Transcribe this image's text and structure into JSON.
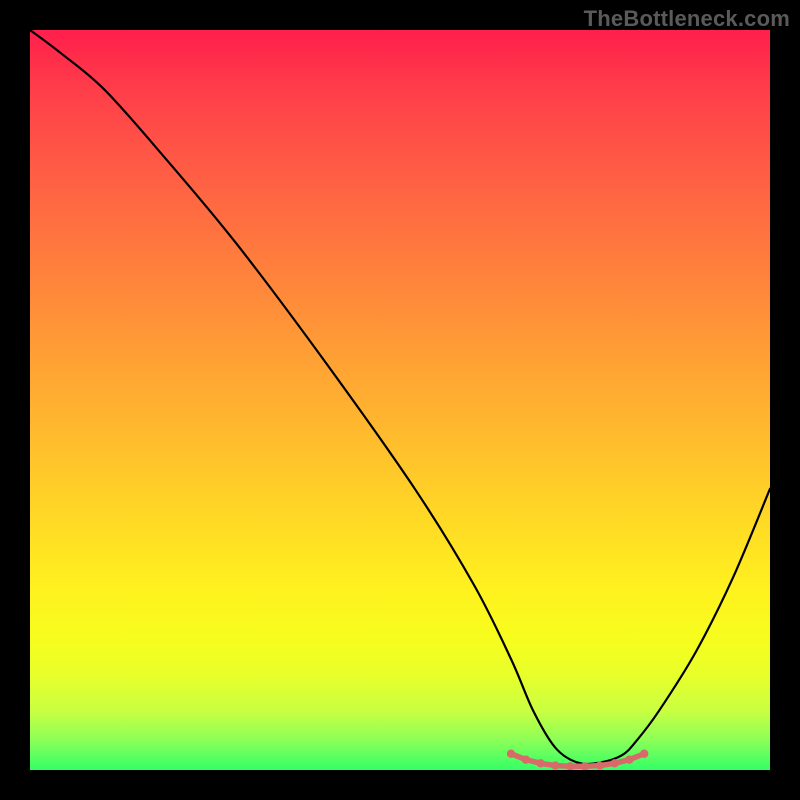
{
  "watermark": "TheBottleneck.com",
  "chart_data": {
    "type": "line",
    "title": "",
    "xlabel": "",
    "ylabel": "",
    "xlim": [
      0,
      100
    ],
    "ylim": [
      0,
      100
    ],
    "series": [
      {
        "name": "curve",
        "x": [
          0,
          4,
          10,
          18,
          28,
          40,
          52,
          60,
          65,
          68,
          71,
          74,
          77,
          80,
          82,
          85,
          90,
          95,
          100
        ],
        "y": [
          100,
          97,
          92,
          83,
          71,
          55,
          38,
          25,
          15,
          8,
          3,
          1,
          1,
          2,
          4,
          8,
          16,
          26,
          38
        ]
      }
    ],
    "markers": {
      "name": "bottom-markers",
      "color": "#d86a6a",
      "x": [
        65,
        67,
        69,
        71,
        73,
        75,
        77,
        79,
        81,
        83
      ],
      "y": [
        2.2,
        1.4,
        0.9,
        0.6,
        0.5,
        0.5,
        0.6,
        0.9,
        1.4,
        2.2
      ]
    },
    "gradient_stops": [
      {
        "pos": 0.0,
        "color": "#ff1f4b"
      },
      {
        "pos": 0.08,
        "color": "#ff3d4a"
      },
      {
        "pos": 0.18,
        "color": "#ff5a45"
      },
      {
        "pos": 0.3,
        "color": "#ff7a3e"
      },
      {
        "pos": 0.42,
        "color": "#ff9a36"
      },
      {
        "pos": 0.54,
        "color": "#ffb92e"
      },
      {
        "pos": 0.65,
        "color": "#ffd626"
      },
      {
        "pos": 0.75,
        "color": "#fff01f"
      },
      {
        "pos": 0.82,
        "color": "#f7fd1d"
      },
      {
        "pos": 0.87,
        "color": "#e9ff2a"
      },
      {
        "pos": 0.92,
        "color": "#c9ff41"
      },
      {
        "pos": 0.96,
        "color": "#8bff58"
      },
      {
        "pos": 1.0,
        "color": "#33ff66"
      }
    ]
  }
}
